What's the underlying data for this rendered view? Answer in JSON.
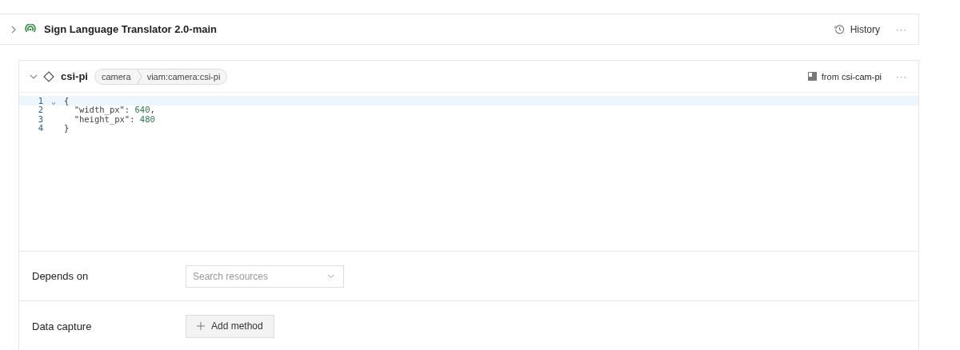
{
  "machine": {
    "name": "Sign Language Translator 2.0-main",
    "expanded": false,
    "history": "History",
    "more": "···"
  },
  "component": {
    "name": "csi-pi",
    "expanded": true,
    "type": "camera",
    "model": "viam:camera:csi-pi",
    "source_prefix": "from ",
    "source": "csi-cam-pi",
    "more": "···",
    "editor": {
      "lines": [
        {
          "number": "1",
          "active": true,
          "foldable": true,
          "tokens": [
            {
              "kind": "punct",
              "text": "{"
            }
          ]
        },
        {
          "number": "2",
          "active": false,
          "foldable": false,
          "tokens": [
            {
              "kind": "key",
              "text": "  \"width_px\""
            },
            {
              "kind": "punct",
              "text": ": "
            },
            {
              "kind": "number",
              "text": "640"
            },
            {
              "kind": "punct",
              "text": ","
            }
          ]
        },
        {
          "number": "3",
          "active": false,
          "foldable": false,
          "tokens": [
            {
              "kind": "key",
              "text": "  \"height_px\""
            },
            {
              "kind": "punct",
              "text": ": "
            },
            {
              "kind": "number",
              "text": "480"
            }
          ]
        },
        {
          "number": "4",
          "active": false,
          "foldable": false,
          "tokens": [
            {
              "kind": "punct",
              "text": "}"
            }
          ]
        }
      ]
    },
    "depends_on": {
      "label": "Depends on",
      "placeholder": "Search resources"
    },
    "data_capture": {
      "label": "Data capture",
      "button": "Add method"
    }
  }
}
